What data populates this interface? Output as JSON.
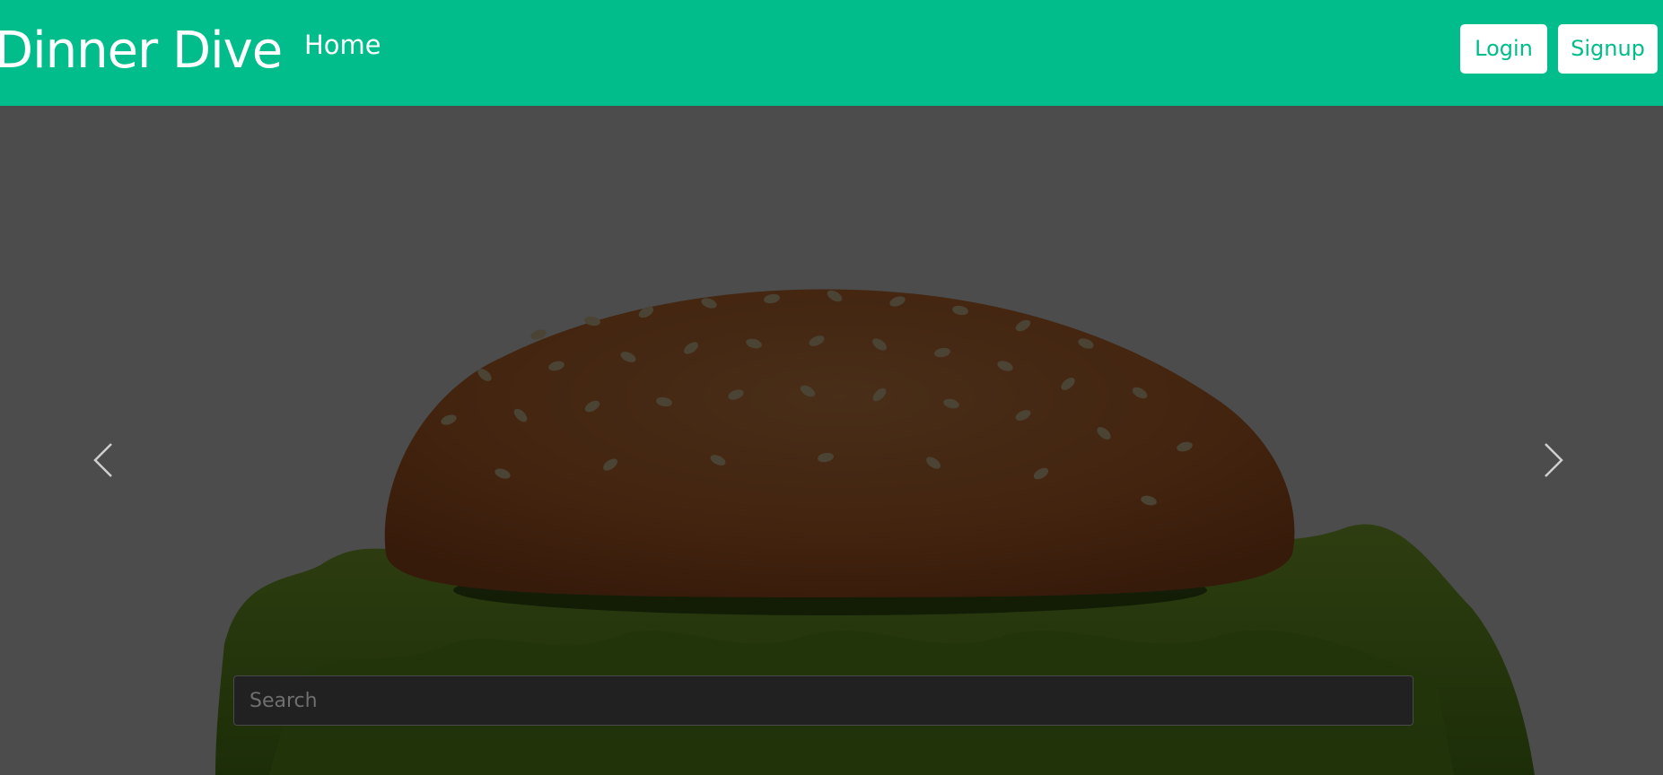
{
  "navbar": {
    "brand": "Dinner Dive",
    "home_label": "Home",
    "login_label": "Login",
    "signup_label": "Signup",
    "bg_color": "#00bd8b"
  },
  "hero": {
    "image": "hamburger",
    "prev_icon": "chevron-left-icon",
    "next_icon": "chevron-right-icon"
  },
  "search": {
    "placeholder": "Search",
    "value": ""
  }
}
